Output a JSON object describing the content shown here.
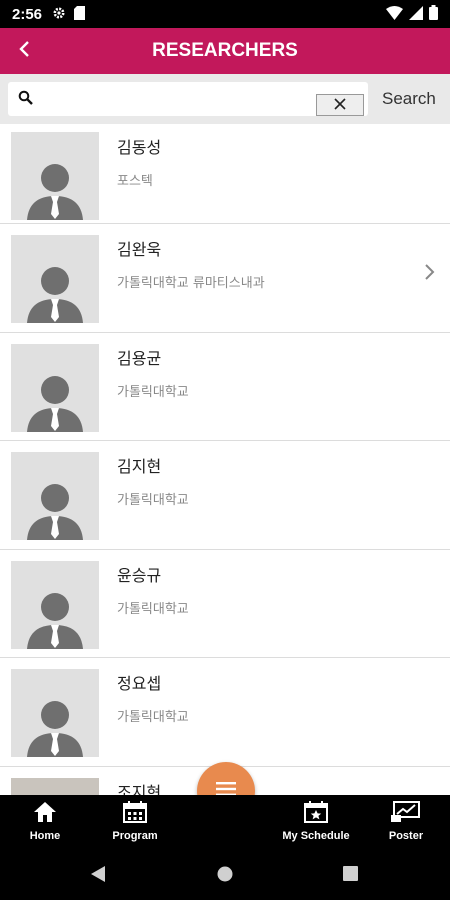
{
  "status_bar": {
    "time": "2:56"
  },
  "header": {
    "title": "RESEARCHERS"
  },
  "search": {
    "value": "",
    "placeholder": "",
    "button_label": "Search"
  },
  "researchers": [
    {
      "name": "김동성",
      "affiliation": "포스텍"
    },
    {
      "name": "김완욱",
      "affiliation": "가톨릭대학교 류마티스내과"
    },
    {
      "name": "김용균",
      "affiliation": "가톨릭대학교"
    },
    {
      "name": "김지현",
      "affiliation": "가톨릭대학교"
    },
    {
      "name": "윤승규",
      "affiliation": "가톨릭대학교"
    },
    {
      "name": "정요셉",
      "affiliation": "가톨릭대학교"
    },
    {
      "name": "조지현",
      "affiliation": ""
    }
  ],
  "bottom_nav": {
    "home": "Home",
    "program": "Program",
    "my_schedule": "My Schedule",
    "poster": "Poster"
  },
  "colors": {
    "header": "#c2185b",
    "fab": "#e88a4e",
    "avatar_bg": "#e0e0e0"
  },
  "icons": [
    "settings-icon",
    "sd-card-icon",
    "wifi-icon",
    "signal-icon",
    "battery-icon",
    "back-arrow-icon",
    "search-icon",
    "clear-icon",
    "chevron-right-icon",
    "menu-icon",
    "home-icon",
    "calendar-icon",
    "star-calendar-icon",
    "poster-icon"
  ]
}
